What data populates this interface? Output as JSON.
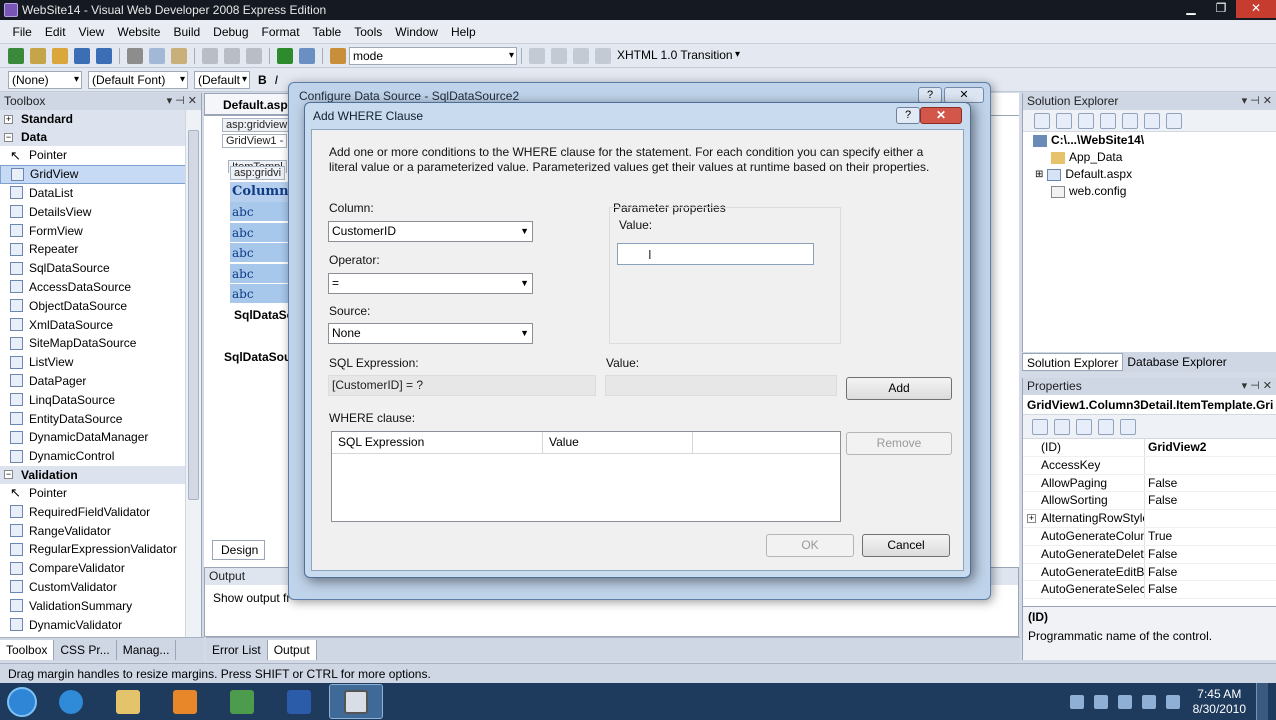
{
  "window": {
    "title": "WebSite14 - Visual Web Developer 2008 Express Edition"
  },
  "menu": [
    "File",
    "Edit",
    "View",
    "Website",
    "Build",
    "Debug",
    "Format",
    "Table",
    "Tools",
    "Window",
    "Help"
  ],
  "toolbar1": {
    "mode_value": "mode",
    "doctype_value": "XHTML 1.0 Transition"
  },
  "toolbar2": {
    "style_value": "(None)",
    "font_value": "(Default Font)",
    "size_value": "(Default",
    "bold": "B",
    "italic": "I"
  },
  "toolbox": {
    "title": "Toolbox",
    "categories": {
      "standard": "Standard",
      "data": "Data",
      "validation": "Validation"
    },
    "data_items": [
      "Pointer",
      "GridView",
      "DataList",
      "DetailsView",
      "FormView",
      "Repeater",
      "SqlDataSource",
      "AccessDataSource",
      "ObjectDataSource",
      "XmlDataSource",
      "SiteMapDataSource",
      "ListView",
      "DataPager",
      "LinqDataSource",
      "EntityDataSource",
      "DynamicDataManager",
      "DynamicControl"
    ],
    "validation_items": [
      "Pointer",
      "RequiredFieldValidator",
      "RangeValidator",
      "RegularExpressionValidator",
      "CompareValidator",
      "CustomValidator",
      "ValidationSummary",
      "DynamicValidator"
    ],
    "selected": "GridView"
  },
  "bottom_tabs": [
    "Toolbox",
    "CSS Pr...",
    "Manag...",
    "Error List",
    "Output"
  ],
  "editor": {
    "doc_tab": "Default.aspx",
    "tag_gridview": "asp:gridview",
    "gridview_label": "GridView1 -",
    "tag_gridvi": "asp:gridvi",
    "item_template": "ItemTempl",
    "column_header": "Column0",
    "cells": [
      "abc",
      "abc",
      "abc",
      "abc",
      "abc"
    ],
    "sqldatasource_inner": "SqlDataSo",
    "sqldatasource_outer": "SqlDataSou",
    "design_tab": "Design"
  },
  "output": {
    "title": "Output",
    "text": "Show output fr"
  },
  "solution_explorer": {
    "title": "Solution Explorer",
    "root": "C:\\...\\WebSite14\\",
    "items": [
      "App_Data",
      "Default.aspx",
      "web.config"
    ],
    "tabs": [
      "Solution Explorer",
      "Database Explorer"
    ]
  },
  "properties": {
    "title": "Properties",
    "object": "GridView1.Column3Detail.ItemTemplate.Gri",
    "rows": [
      {
        "name": "(ID)",
        "value": "GridView2"
      },
      {
        "name": "AccessKey",
        "value": ""
      },
      {
        "name": "AllowPaging",
        "value": "False"
      },
      {
        "name": "AllowSorting",
        "value": "False"
      },
      {
        "name": "AlternatingRowStyle",
        "value": ""
      },
      {
        "name": "AutoGenerateColum",
        "value": "True"
      },
      {
        "name": "AutoGenerateDeleteE",
        "value": "False"
      },
      {
        "name": "AutoGenerateEditBut",
        "value": "False"
      },
      {
        "name": "AutoGenerateSelectB",
        "value": "False"
      }
    ],
    "desc_title": "(ID)",
    "desc_text": "Programmatic name of the control."
  },
  "status_bar": "Drag margin handles to resize margins. Press SHIFT or CTRL for more options.",
  "taskbar": {
    "time": "7:45 AM",
    "date": "8/30/2010"
  },
  "configure_dialog": {
    "title": "Configure Data Source - SqlDataSource2",
    "help": "?"
  },
  "where_dialog": {
    "title": "Add WHERE Clause",
    "help": "?",
    "close": "✕",
    "intro": "Add one or more conditions to the WHERE clause for the statement. For each condition you can specify either a literal value or a parameterized value. Parameterized values get their values at runtime based on their properties.",
    "column_label": "Column:",
    "column_value": "CustomerID",
    "operator_label": "Operator:",
    "operator_value": "=",
    "source_label": "Source:",
    "source_value": "None",
    "param_props_label": "Parameter properties",
    "param_value_label": "Value:",
    "sql_expr_label": "SQL Expression:",
    "sql_expr_value": "[CustomerID] = ?",
    "value_label": "Value:",
    "value_value": "",
    "add_button": "Add",
    "where_label": "WHERE clause:",
    "grid_columns": [
      "SQL Expression",
      "Value"
    ],
    "remove_button": "Remove",
    "ok_button": "OK",
    "cancel_button": "Cancel"
  }
}
